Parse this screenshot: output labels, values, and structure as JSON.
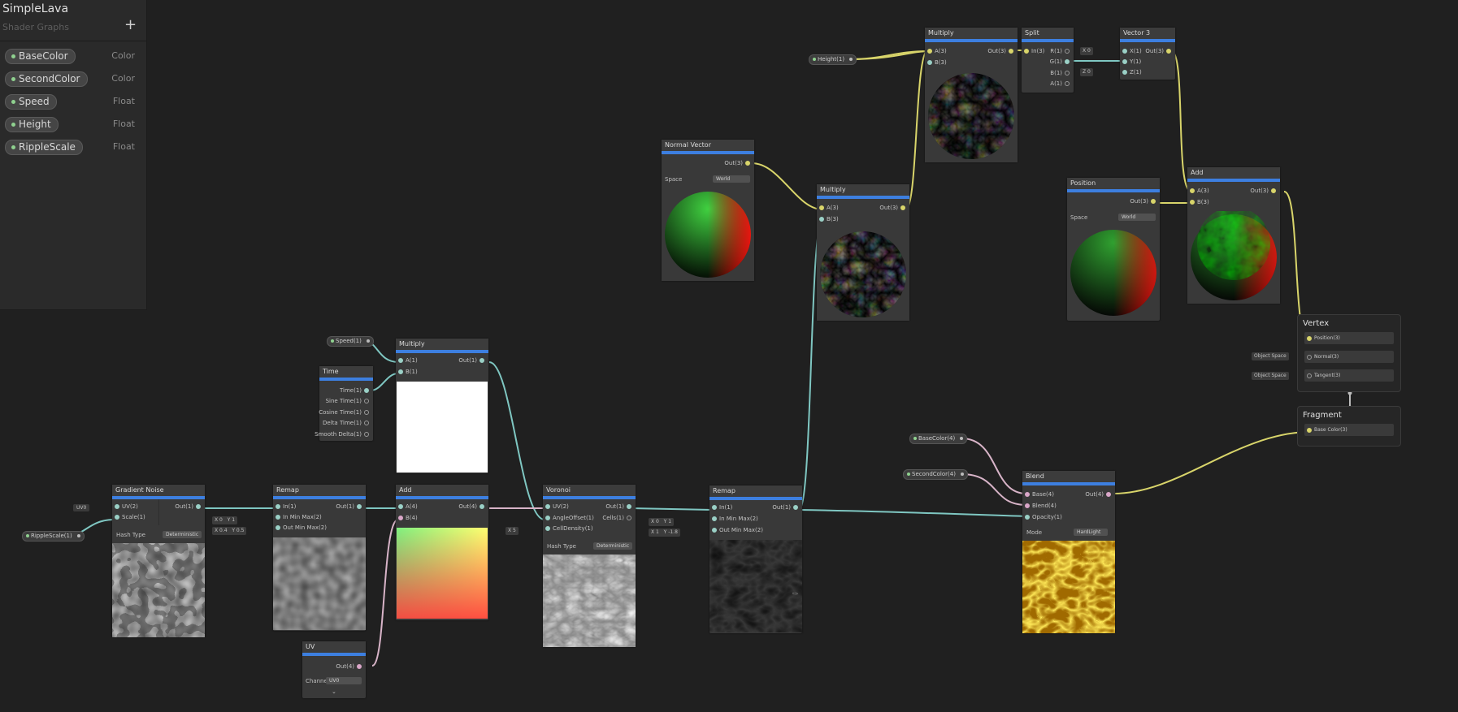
{
  "blackboard": {
    "title": "SimpleLava",
    "subtitle": "Shader Graphs",
    "add_icon": "plus-icon",
    "properties": [
      {
        "name": "BaseColor",
        "type": "Color"
      },
      {
        "name": "SecondColor",
        "type": "Color"
      },
      {
        "name": "Speed",
        "type": "Float"
      },
      {
        "name": "Height",
        "type": "Float"
      },
      {
        "name": "RippleScale",
        "type": "Float"
      }
    ]
  },
  "accent": "#3d7fe0",
  "nodes": {
    "gradient": {
      "title": "Gradient Noise",
      "in1": "UV(2)",
      "in2": "Scale(1)",
      "out": "Out(1)",
      "hash_label": "Hash Type",
      "hash_value": "Deterministic"
    },
    "remap1": {
      "title": "Remap",
      "in1": "In(1)",
      "in2": "In Min Max(2)",
      "in3": "Out Min Max(2)",
      "out": "Out(1)"
    },
    "time": {
      "title": "Time",
      "p1": "Time(1)",
      "p2": "Sine Time(1)",
      "p3": "Cosine Time(1)",
      "p4": "Delta Time(1)",
      "p5": "Smooth Delta(1)"
    },
    "multiply1": {
      "title": "Multiply",
      "in1": "A(1)",
      "in2": "B(1)",
      "out": "Out(1)"
    },
    "add1": {
      "title": "Add",
      "in1": "A(4)",
      "in2": "B(4)",
      "out": "Out(4)"
    },
    "uv": {
      "title": "UV",
      "out": "Out(4)",
      "channel_label": "Channel",
      "channel_value": "UV0"
    },
    "voronoi": {
      "title": "Voronoi",
      "in1": "UV(2)",
      "in2": "AngleOffset(1)",
      "in3": "CellDensity(1)",
      "out1": "Out(1)",
      "out2": "Cells(1)",
      "hash_label": "Hash Type",
      "hash_value": "Deterministic"
    },
    "remap2": {
      "title": "Remap",
      "in1": "In(1)",
      "in2": "In Min Max(2)",
      "in3": "Out Min Max(2)",
      "out": "Out(1)"
    },
    "normal": {
      "title": "Normal Vector",
      "out": "Out(3)",
      "space_label": "Space",
      "space_value": "World"
    },
    "multiply2": {
      "title": "Multiply",
      "in1": "A(3)",
      "in2": "B(3)",
      "out": "Out(3)"
    },
    "multiply3": {
      "title": "Multiply",
      "in1": "A(3)",
      "in2": "B(3)",
      "out": "Out(3)"
    },
    "split": {
      "title": "Split",
      "in1": "In(3)",
      "o1": "R(1)",
      "o2": "G(1)",
      "o3": "B(1)",
      "o4": "A(1)"
    },
    "vector3": {
      "title": "Vector 3",
      "in1": "X(1)",
      "in2": "Y(1)",
      "in3": "Z(1)",
      "out": "Out(3)"
    },
    "position": {
      "title": "Position",
      "out": "Out(3)",
      "space_label": "Space",
      "space_value": "World"
    },
    "add2": {
      "title": "Add",
      "in1": "A(3)",
      "in2": "B(3)",
      "out": "Out(3)"
    },
    "blend": {
      "title": "Blend",
      "in1": "Base(4)",
      "in2": "Blend(4)",
      "in3": "Opacity(1)",
      "out": "Out(4)",
      "mode_label": "Mode",
      "mode_value": "HardLight"
    }
  },
  "prop_nodes": {
    "speed": "Speed(1)",
    "height": "Height(1)",
    "ripple": "RippleScale(1)",
    "basecolor": "BaseColor(4)",
    "secondcolor": "SecondColor(4)"
  },
  "inline": {
    "uv0": "UV0",
    "grad_x": "X",
    "grad_x_val": "0",
    "grad_y": "Y",
    "grad_y_val": "1",
    "grad2_x_val": "0.4",
    "grad2_y_val": "0.5",
    "voro_x": "X",
    "voro_x_val": "5",
    "rm2_x": "X",
    "rm2_x_val": "0",
    "rm2_y_val": "1",
    "rm2_x2_val": "1",
    "rm2_y2_val": "-1.8",
    "vec_x": "X",
    "vec_x_val": "0",
    "vec_z": "Z",
    "vec_z_val": "0"
  },
  "master": {
    "vertex_title": "Vertex",
    "position": "Position(3)",
    "normal": "Normal(3)",
    "tangent": "Tangent(3)",
    "object_space": "Object Space",
    "fragment_title": "Fragment",
    "base_color": "Base Color(3)"
  }
}
